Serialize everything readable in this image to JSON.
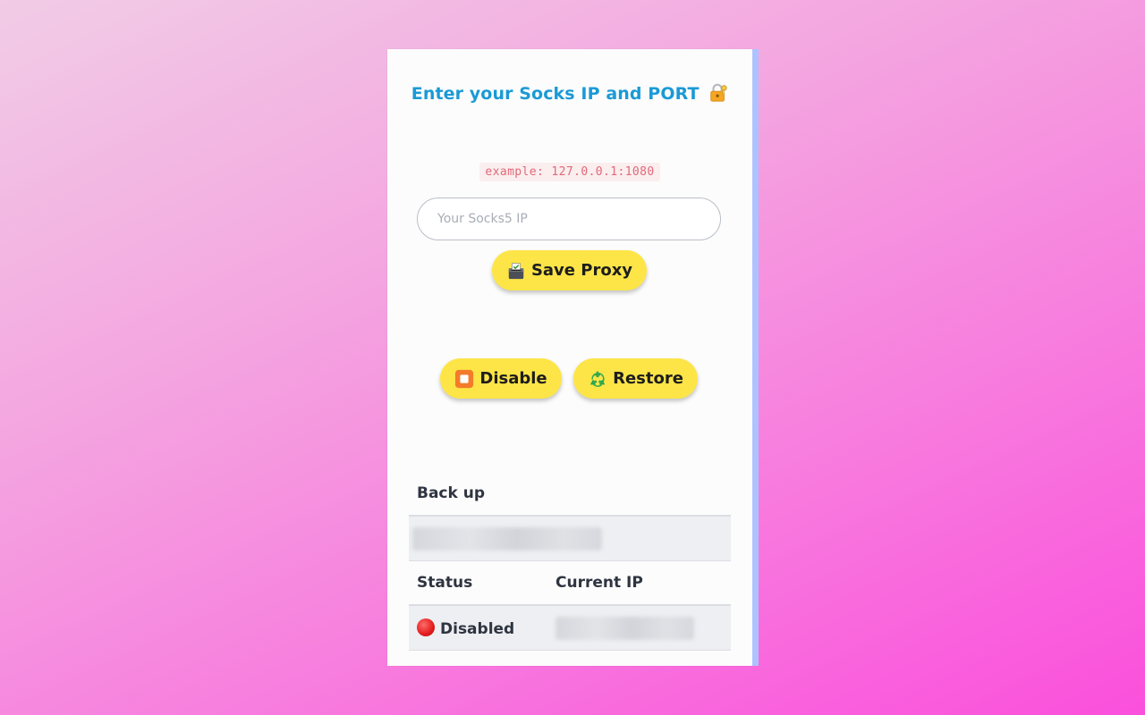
{
  "popup": {
    "title": "Enter your Socks IP and PORT",
    "title_icon": "lock-with-key-icon",
    "hint": "example: 127.0.0.1:1080",
    "input": {
      "placeholder": "Your Socks5 IP",
      "value": ""
    },
    "buttons": {
      "save": {
        "label": "Save Proxy",
        "icon": "ballot-box-icon"
      },
      "disable": {
        "label": "Disable",
        "icon": "stop-button-icon"
      },
      "restore": {
        "label": "Restore",
        "icon": "recycle-icon"
      }
    },
    "backup": {
      "header": "Back up",
      "value_redacted": true
    },
    "status_table": {
      "headers": [
        "Status",
        "Current IP"
      ],
      "status": {
        "label": "Disabled",
        "icon": "red-circle-icon"
      },
      "current_ip_redacted": true
    }
  },
  "colors": {
    "title": "#1a9ad6",
    "button_bg": "#fde547",
    "hint_text": "#e0697a",
    "scrollbar": "#aec2ff",
    "status_red": "#e21b1b"
  }
}
